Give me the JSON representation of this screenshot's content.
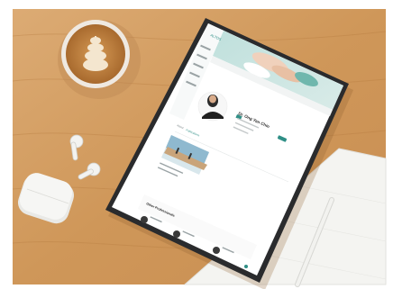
{
  "scene": {
    "colors": {
      "wood_light": "#d9a56c",
      "wood_mid": "#c98f54",
      "wood_dark": "#b87d45",
      "mug": "#efe9e1",
      "coffee": "#c0833f",
      "foam": "#f4e6cf",
      "tablet_frame": "#2a2b2d",
      "screen": "#ffffff",
      "teal": "#2f8f86",
      "paper": "#f6f6f4",
      "airpods": "#f3f3f1"
    },
    "objects": [
      "coffee-cup",
      "airpod-left",
      "airpod-right",
      "airpods-case",
      "tablet",
      "paper-sheet",
      "stylus"
    ]
  },
  "tablet": {
    "logo": "ALTOS",
    "profile_name": "Dr. Ong Yan Chin",
    "tabs": [
      "About",
      "Publications"
    ],
    "section_title": "Other Professionals"
  }
}
